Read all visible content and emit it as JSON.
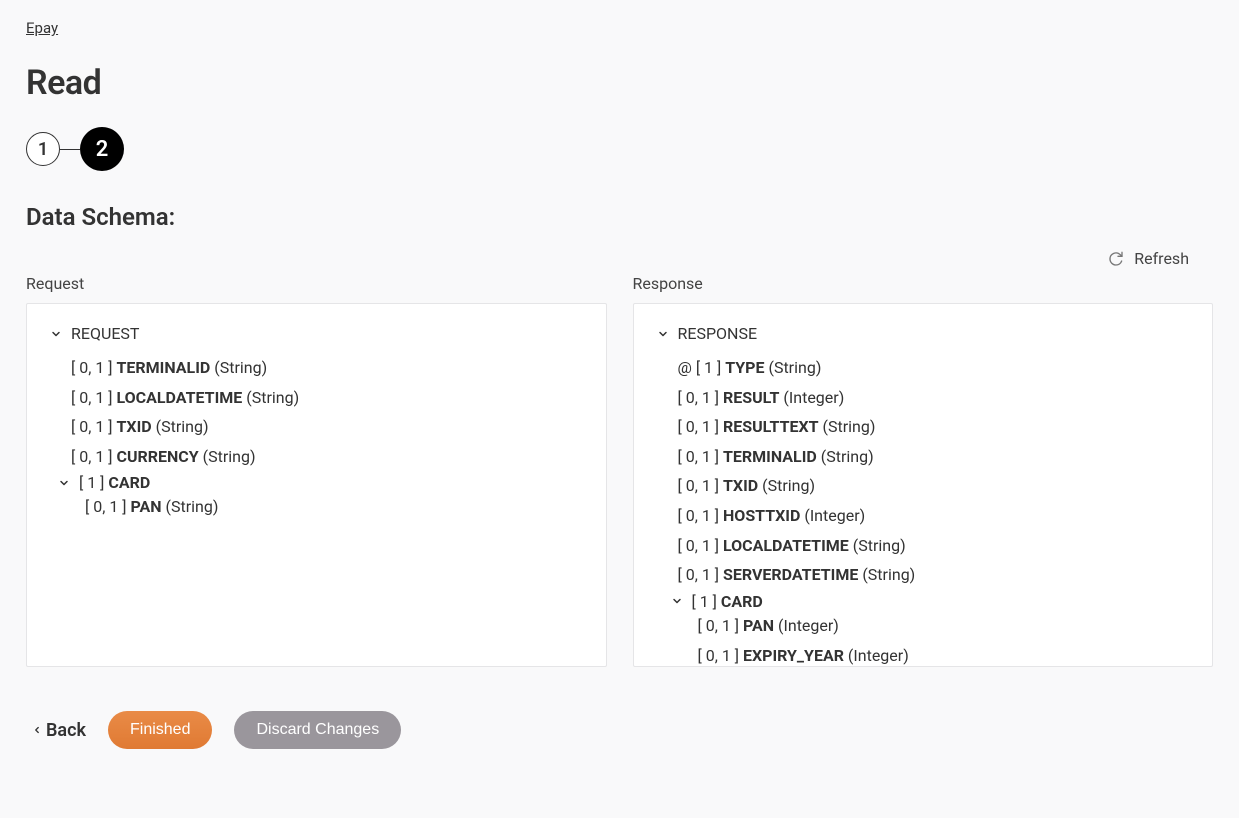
{
  "breadcrumb": "Epay",
  "title": "Read",
  "stepper": {
    "step1": "1",
    "step2": "2"
  },
  "section_title": "Data Schema:",
  "refresh_label": "Refresh",
  "request": {
    "col_label": "Request",
    "root": "REQUEST",
    "fields": [
      {
        "card": "[ 0, 1 ]",
        "name": "TERMINALID",
        "type": "(String)"
      },
      {
        "card": "[ 0, 1 ]",
        "name": "LOCALDATETIME",
        "type": "(String)"
      },
      {
        "card": "[ 0, 1 ]",
        "name": "TXID",
        "type": "(String)"
      },
      {
        "card": "[ 0, 1 ]",
        "name": "CURRENCY",
        "type": "(String)"
      }
    ],
    "nested": {
      "card": "[ 1 ]",
      "name": "CARD",
      "fields": [
        {
          "card": "[ 0, 1 ]",
          "name": "PAN",
          "type": "(String)"
        }
      ]
    }
  },
  "response": {
    "col_label": "Response",
    "root": "RESPONSE",
    "attr": {
      "prefix": "@",
      "card": "[ 1 ]",
      "name": "TYPE",
      "type": "(String)"
    },
    "fields": [
      {
        "card": "[ 0, 1 ]",
        "name": "RESULT",
        "type": "(Integer)"
      },
      {
        "card": "[ 0, 1 ]",
        "name": "RESULTTEXT",
        "type": "(String)"
      },
      {
        "card": "[ 0, 1 ]",
        "name": "TERMINALID",
        "type": "(String)"
      },
      {
        "card": "[ 0, 1 ]",
        "name": "TXID",
        "type": "(String)"
      },
      {
        "card": "[ 0, 1 ]",
        "name": "HOSTTXID",
        "type": "(Integer)"
      },
      {
        "card": "[ 0, 1 ]",
        "name": "LOCALDATETIME",
        "type": "(String)"
      },
      {
        "card": "[ 0, 1 ]",
        "name": "SERVERDATETIME",
        "type": "(String)"
      }
    ],
    "nested": {
      "card": "[ 1 ]",
      "name": "CARD",
      "fields": [
        {
          "card": "[ 0, 1 ]",
          "name": "PAN",
          "type": "(Integer)"
        },
        {
          "card": "[ 0, 1 ]",
          "name": "EXPIRY_YEAR",
          "type": "(Integer)"
        }
      ]
    }
  },
  "footer": {
    "back": "Back",
    "finished": "Finished",
    "discard": "Discard Changes"
  }
}
